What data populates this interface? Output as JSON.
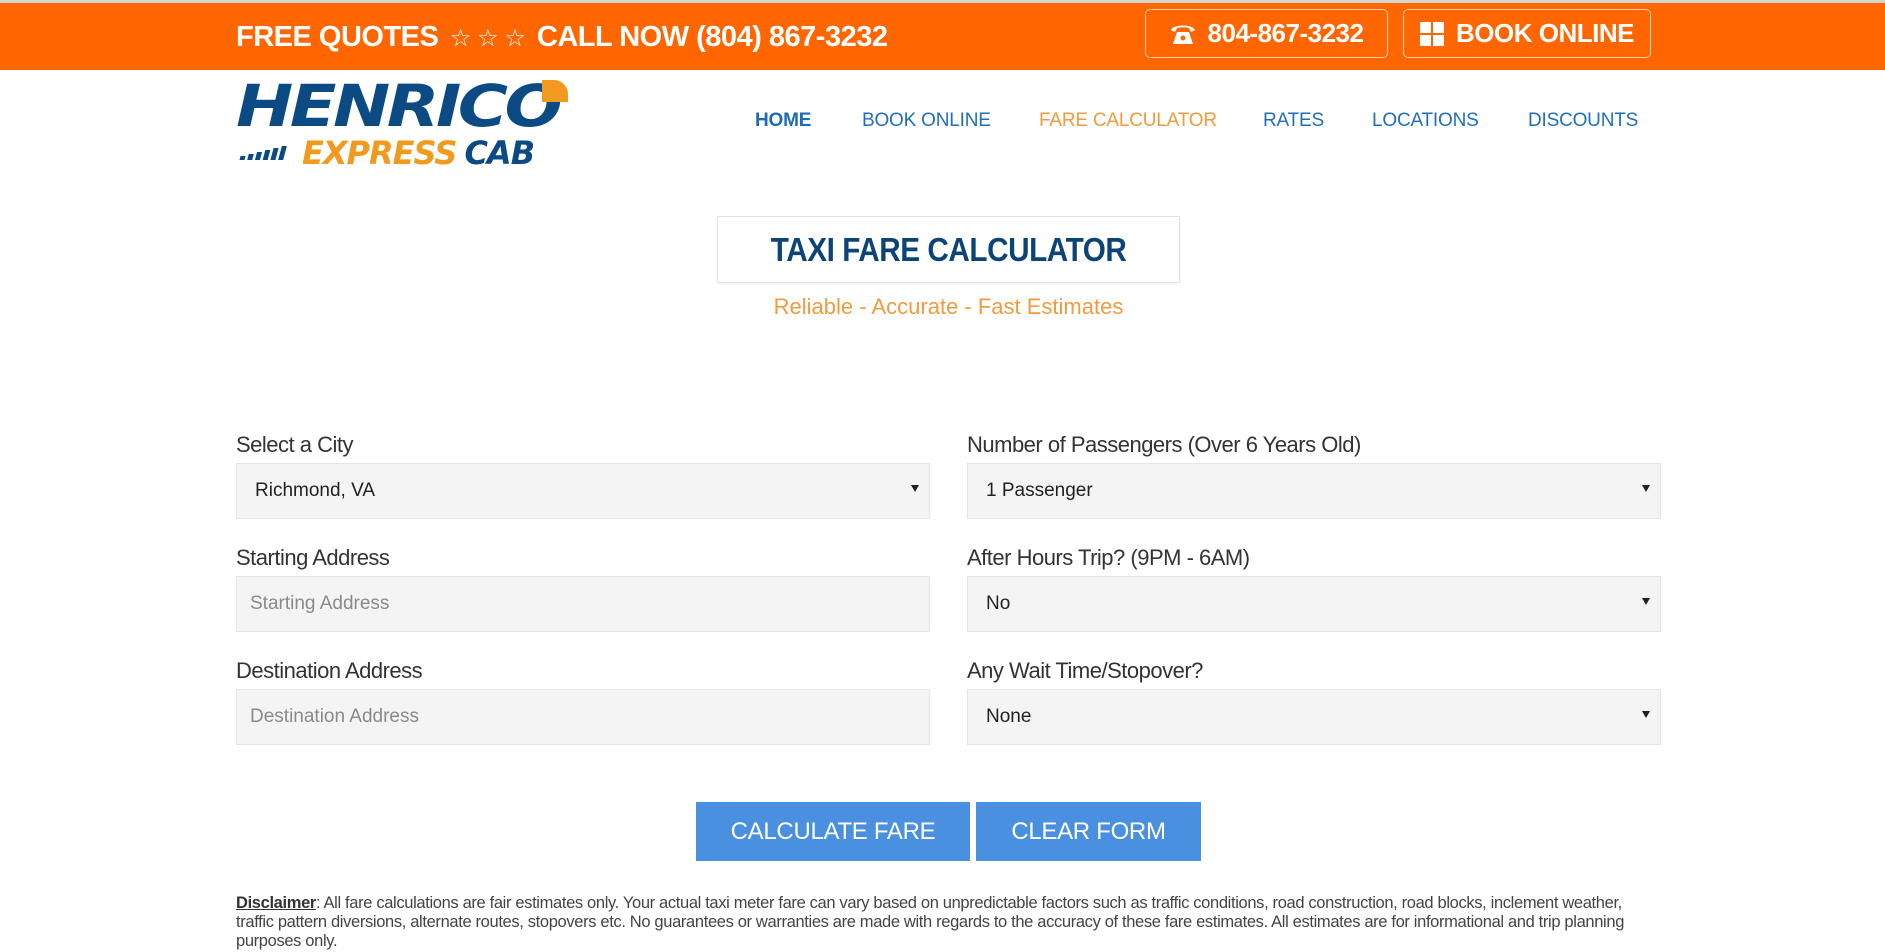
{
  "topbar": {
    "promo_left": "FREE QUOTES",
    "stars": "☆ ☆ ☆",
    "promo_right": "CALL NOW (804) 867-3232",
    "phone_button": {
      "icon": "phone-icon",
      "label": "804-867-3232"
    },
    "book_button": {
      "icon": "grid-icon",
      "label": "BOOK ONLINE"
    }
  },
  "logo": {
    "line1": "HENRICO",
    "line2": "EXPRESS",
    "line2_suffix": "CAB"
  },
  "nav": {
    "items": [
      {
        "label": "HOME",
        "state": "active"
      },
      {
        "label": "BOOK ONLINE",
        "state": "normal"
      },
      {
        "label": "FARE CALCULATOR",
        "state": "current"
      },
      {
        "label": "RATES",
        "state": "normal"
      },
      {
        "label": "LOCATIONS",
        "state": "normal"
      },
      {
        "label": "DISCOUNTS",
        "state": "normal"
      }
    ]
  },
  "page": {
    "title": "TAXI FARE CALCULATOR",
    "subtitle": "Reliable - Accurate - Fast Estimates"
  },
  "form": {
    "city": {
      "label": "Select a City",
      "value": "Richmond, VA"
    },
    "start": {
      "label": "Starting Address",
      "value": "",
      "placeholder": "Starting Address"
    },
    "destination": {
      "label": "Destination Address",
      "value": "",
      "placeholder": "Destination Address"
    },
    "passengers": {
      "label": "Number of Passengers (Over 6 Years Old)",
      "value": "1 Passenger"
    },
    "after_hours": {
      "label": "After Hours Trip? (9PM - 6AM)",
      "value": "No"
    },
    "wait_time": {
      "label": "Any Wait Time/Stopover?",
      "value": "None"
    },
    "calculate_label": "CALCULATE FARE",
    "clear_label": "CLEAR FORM"
  },
  "disclaimer": {
    "label": "Disclaimer",
    "text": ": All fare calculations are fair estimates only. Your actual taxi meter fare can vary based on unpredictable factors such as traffic conditions, road construction, road blocks, inclement weather, traffic pattern diversions, alternate routes, stopovers etc. No guarantees or warranties are made with regards to the accuracy of these fare estimates. All estimates are for informational and trip planning purposes only."
  },
  "colors": {
    "brand_orange": "#ff6600",
    "brand_navy": "#0c4a84",
    "accent_orange": "#f29a3c",
    "nav_blue": "#1f6fbd",
    "button_blue": "#4a90e0"
  }
}
